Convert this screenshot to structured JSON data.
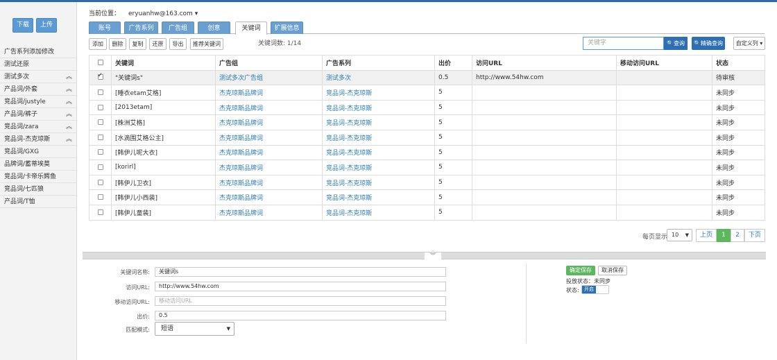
{
  "sidebar": {
    "download_label": "下载",
    "upload_label": "上传",
    "items": [
      {
        "label": "广告系列添加修改",
        "chevron": ""
      },
      {
        "label": "测试还原",
        "chevron": ""
      },
      {
        "label": "测试多次",
        "chevron": "︽"
      },
      {
        "label": "产品词/外套",
        "chevron": "︽"
      },
      {
        "label": "竞品词/justyle",
        "chevron": "︽"
      },
      {
        "label": "产品词/裤子",
        "chevron": "︽"
      },
      {
        "label": "竞品词/zara",
        "chevron": "︽"
      },
      {
        "label": "竞品词-杰克琼斯",
        "chevron": "︽"
      },
      {
        "label": "竞品词/GXG",
        "chevron": ""
      },
      {
        "label": "品牌词/蓄蒂埃莫",
        "chevron": ""
      },
      {
        "label": "竞品词/卡帝乐鳄鱼",
        "chevron": ""
      },
      {
        "label": "竞品词/七匹狼",
        "chevron": ""
      },
      {
        "label": "产品词/T恤",
        "chevron": ""
      }
    ]
  },
  "header": {
    "location_label": "当前位置：",
    "account": "eryuanhw@163.com",
    "account_caret": "▾"
  },
  "tabs": [
    "账号",
    "广告系列",
    "广告组",
    "创意",
    "关键词",
    "扩展信息"
  ],
  "toolbar": {
    "buttons": [
      "添加",
      "删除",
      "复制",
      "还原",
      "导出",
      "推荐关键词"
    ],
    "keyword_count": "关键词数: 1/14"
  },
  "search": {
    "placeholder": "关键字",
    "search_label": "🔍查询",
    "precise_label": "🔍精确查询",
    "custom_label": "自定义列 ▾"
  },
  "table": {
    "headers": [
      "关键词",
      "广告组",
      "广告系列",
      "出价",
      "访问URL",
      "移动访问URL",
      "状态"
    ],
    "rows": [
      {
        "checked": true,
        "keyword": "\"关键词s\"",
        "group": "测试多次广告组",
        "series": "测试多次",
        "bid": "0.5",
        "url": "http://www.54hw.com",
        "murl": "",
        "status": "待审核"
      },
      {
        "checked": false,
        "keyword": "[睡衣etam艾格]",
        "group": "杰克琼斯品牌词",
        "series": "竞品词-杰克琼斯",
        "bid": "5",
        "url": "",
        "murl": "",
        "status": "未同步"
      },
      {
        "checked": false,
        "keyword": "[2013etam]",
        "group": "杰克琼斯品牌词",
        "series": "竞品词-杰克琼斯",
        "bid": "5",
        "url": "",
        "murl": "",
        "status": "未同步"
      },
      {
        "checked": false,
        "keyword": "[株洲艾格]",
        "group": "杰克琼斯品牌词",
        "series": "竞品词-杰克琼斯",
        "bid": "5",
        "url": "",
        "murl": "",
        "status": "未同步"
      },
      {
        "checked": false,
        "keyword": "[水滴围艾格公主]",
        "group": "杰克琼斯品牌词",
        "series": "竞品词-杰克琼斯",
        "bid": "5",
        "url": "",
        "murl": "",
        "status": "未同步"
      },
      {
        "checked": false,
        "keyword": "[韩伊儿呢大衣]",
        "group": "杰克琼斯品牌词",
        "series": "竞品词-杰克琼斯",
        "bid": "5",
        "url": "",
        "murl": "",
        "status": "未同步"
      },
      {
        "checked": false,
        "keyword": "[korirl]",
        "group": "杰克琼斯品牌词",
        "series": "竞品词-杰克琼斯",
        "bid": "5",
        "url": "",
        "murl": "",
        "status": "未同步"
      },
      {
        "checked": false,
        "keyword": "[韩伊儿卫衣]",
        "group": "杰克琼斯品牌词",
        "series": "竞品词-杰克琼斯",
        "bid": "5",
        "url": "",
        "murl": "",
        "status": "未同步"
      },
      {
        "checked": false,
        "keyword": "[韩伊儿小西装]",
        "group": "杰克琼斯品牌词",
        "series": "竞品词-杰克琼斯",
        "bid": "5",
        "url": "",
        "murl": "",
        "status": "未同步"
      },
      {
        "checked": false,
        "keyword": "[韩伊儿童装]",
        "group": "杰克琼斯品牌词",
        "series": "竞品词-杰克琼斯",
        "bid": "5",
        "url": "",
        "murl": "",
        "status": "未同步"
      }
    ]
  },
  "pager": {
    "per_page_label": "每页显示",
    "per_page": "10",
    "prev": "上页",
    "pages": [
      "1",
      "2"
    ],
    "next": "下页"
  },
  "splitter": {
    "handle": "︾"
  },
  "form": {
    "name_label": "关键词名称:",
    "name_value": "关键词s",
    "url_label": "访问URL:",
    "url_value": "http://www.54hw.com",
    "murl_label": "移动访问URL:",
    "murl_placeholder": "移动访问URL",
    "bid_label": "出价:",
    "bid_value": "0.5",
    "match_label": "匹配模式:",
    "match_value": "短语"
  },
  "right_panel": {
    "save_label": "确定保存",
    "cancel_label": "取消保存",
    "delivery_status": "投放状态：未同步",
    "status_label": "状态:",
    "toggle_on": "开启"
  },
  "colors": {
    "accent": "#2c6fb5",
    "tab": "#6a9fd2",
    "success": "#5cb85c",
    "link": "#2a7ab8"
  }
}
